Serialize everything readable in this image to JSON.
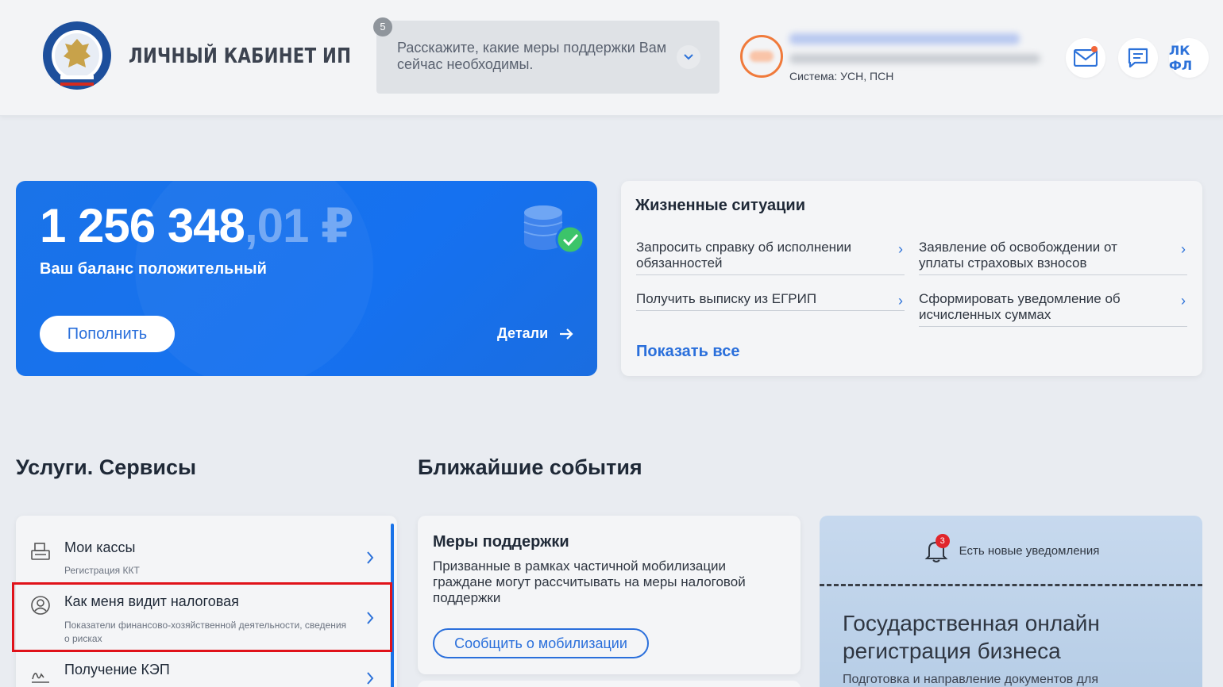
{
  "header": {
    "cabinet_title": "ЛИЧНЫЙ КАБИНЕТ ИП",
    "logo_icon": "fns-emblem-icon",
    "survey": {
      "badge": "5",
      "text": "Расскажите, какие меры поддержки Вам сейчас необходимы."
    },
    "user": {
      "system": "Система: УСН, ПСН"
    },
    "icons": {
      "mail": "mail-icon",
      "chat": "chat-icon",
      "lkfl_label": "ЛК ФЛ"
    }
  },
  "balance": {
    "amount_main": "1 256 348",
    "amount_cents": ",01 ₽",
    "status": "Ваш баланс положительный",
    "topup_label": "Пополнить",
    "details_label": "Детали"
  },
  "life_situations": {
    "title": "Жизненные ситуации",
    "items": [
      {
        "label": "Запросить справку об исполнении обязанностей"
      },
      {
        "label": "Заявление об освобождении от уплаты страховых взносов"
      },
      {
        "label": "Получить выписку из ЕГРИП"
      },
      {
        "label": "Сформировать уведомление об исчисленных суммах"
      }
    ],
    "show_all": "Показать все"
  },
  "services": {
    "title": "Услуги. Сервисы",
    "items": [
      {
        "title": "Мои кассы",
        "subtitle": "Регистрация ККТ",
        "icon": "cash-register-icon"
      },
      {
        "title": "Как меня видит налоговая",
        "subtitle": "Показатели финансово-хозяйственной деятельности, сведения о рисках",
        "icon": "user-search-icon"
      },
      {
        "title": "Получение КЭП",
        "subtitle": "",
        "icon": "signature-icon"
      }
    ]
  },
  "events": {
    "title": "Ближайшие события",
    "card": {
      "title": "Меры поддержки",
      "text": "Призванные в рамках частичной мобилизации граждане могут рассчитывать на меры налоговой поддержки",
      "button": "Сообщить о мобилизации"
    }
  },
  "promo": {
    "notif_badge": "3",
    "notif_text": "Есть новые уведомления",
    "title": "Государственная онлайн регистрация бизнеса",
    "subtitle": "Подготовка и направление документов для"
  },
  "colors": {
    "accent": "#1a73e8",
    "highlight": "#e0121a"
  }
}
